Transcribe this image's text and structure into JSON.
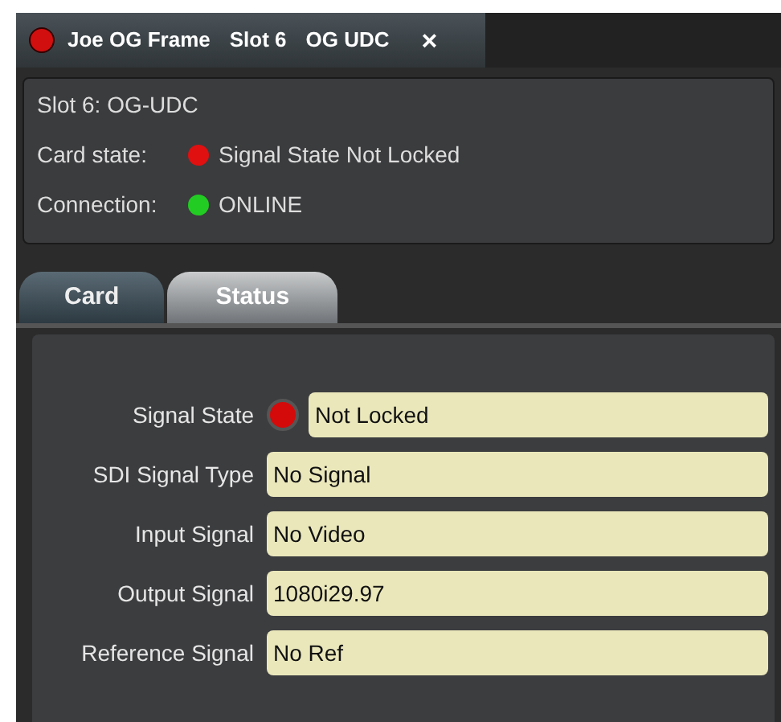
{
  "window": {
    "title_parts": [
      "Joe OG Frame",
      "Slot 6",
      "OG UDC"
    ],
    "close": "×",
    "alarm": true
  },
  "info": {
    "heading": "Slot 6: OG-UDC",
    "rows": [
      {
        "label": "Card state:",
        "value": "Signal State Not Locked",
        "color": "#e01010"
      },
      {
        "label": "Connection:",
        "value": "ONLINE",
        "color": "#22cc22"
      }
    ]
  },
  "tabs": [
    {
      "label": "Card",
      "selected": false
    },
    {
      "label": "Status",
      "selected": true
    }
  ],
  "fields": [
    {
      "label": "Signal State",
      "value": "Not Locked",
      "color": "#d40a0a"
    },
    {
      "label": "SDI Signal Type",
      "value": "No Signal"
    },
    {
      "label": "Input Signal",
      "value": "No Video"
    },
    {
      "label": "Output Signal",
      "value": "1080i29.97"
    },
    {
      "label": "Reference Signal",
      "value": "No Ref"
    }
  ]
}
